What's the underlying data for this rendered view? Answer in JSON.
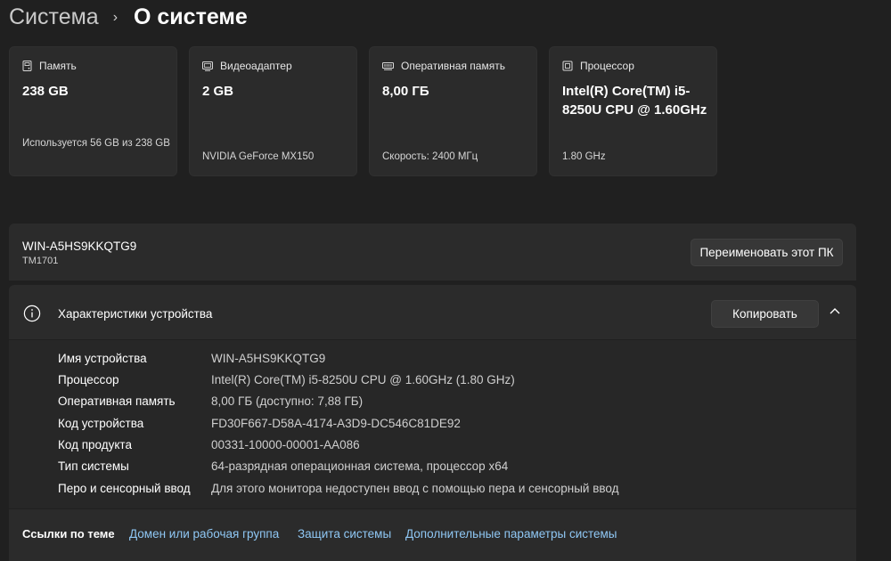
{
  "breadcrumb": {
    "parent": "Система",
    "separator": "›",
    "current": "О системе"
  },
  "cards": [
    {
      "icon": "storage-icon",
      "title": "Память",
      "value": "238 GB",
      "sub": "Используется 56 GB из 238 GB"
    },
    {
      "icon": "display-adapter-icon",
      "title": "Видеоадаптер",
      "value": "2 GB",
      "sub": "NVIDIA GeForce MX150"
    },
    {
      "icon": "ram-icon",
      "title": "Оперативная память",
      "value": "8,00 ГБ",
      "sub": "Скорость: 2400 МГц"
    },
    {
      "icon": "cpu-icon",
      "title": "Процессор",
      "value": "Intel(R) Core(TM) i5-8250U CPU @ 1.60GHz",
      "sub": "1.80 GHz"
    }
  ],
  "pc": {
    "name": "WIN-A5HS9KKQTG9",
    "model": "TM1701",
    "rename_label": "Переименовать этот ПК"
  },
  "specs": {
    "title": "Характеристики устройства",
    "copy_label": "Копировать",
    "rows": [
      {
        "key": "Имя устройства",
        "value": "WIN-A5HS9KKQTG9"
      },
      {
        "key": "Процессор",
        "value": "Intel(R) Core(TM) i5-8250U CPU @ 1.60GHz   (1.80 GHz)"
      },
      {
        "key": "Оперативная память",
        "value": "8,00 ГБ (доступно: 7,88 ГБ)"
      },
      {
        "key": "Код устройства",
        "value": "FD30F667-D58A-4174-A3D9-DC546C81DE92"
      },
      {
        "key": "Код продукта",
        "value": "00331-10000-00001-AA086"
      },
      {
        "key": "Тип системы",
        "value": "64-разрядная операционная система, процессор x64"
      },
      {
        "key": "Перо и сенсорный ввод",
        "value": "Для этого монитора недоступен ввод с помощью пера и сенсорный ввод"
      }
    ]
  },
  "links": {
    "label": "Ссылки по теме",
    "items": [
      "Домен или рабочая группа",
      "Защита системы",
      "Дополнительные параметры системы"
    ]
  },
  "colors": {
    "background": "#202020",
    "card": "#2b2b2b",
    "link": "#8fc7f4"
  }
}
